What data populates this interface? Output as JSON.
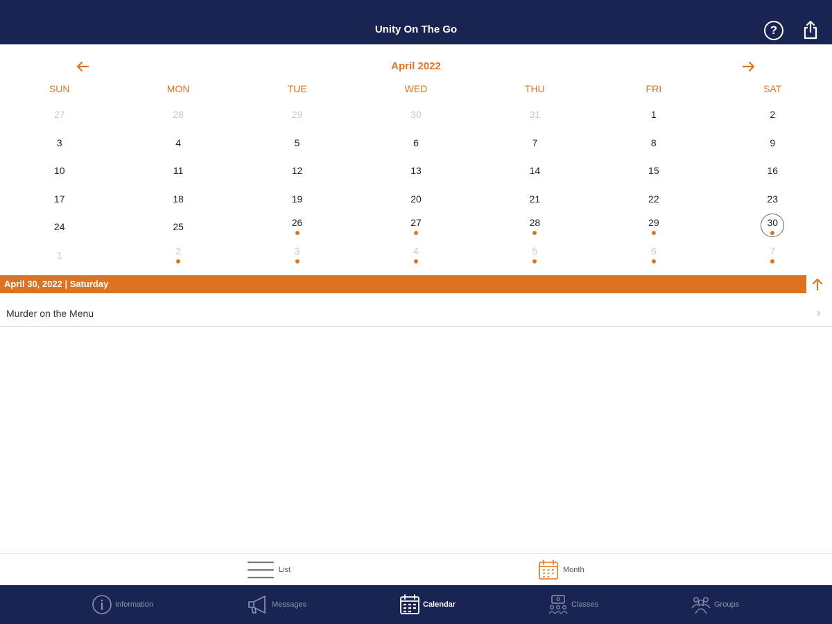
{
  "header": {
    "title": "Unity On The Go",
    "help_glyph": "?"
  },
  "calendar": {
    "month_label": "April 2022",
    "weekdays": [
      "SUN",
      "MON",
      "TUE",
      "WED",
      "THU",
      "FRI",
      "SAT"
    ],
    "weeks": [
      [
        {
          "d": "27",
          "other": true
        },
        {
          "d": "28",
          "other": true
        },
        {
          "d": "29",
          "other": true
        },
        {
          "d": "30",
          "other": true
        },
        {
          "d": "31",
          "other": true
        },
        {
          "d": "1"
        },
        {
          "d": "2"
        }
      ],
      [
        {
          "d": "3"
        },
        {
          "d": "4"
        },
        {
          "d": "5"
        },
        {
          "d": "6"
        },
        {
          "d": "7"
        },
        {
          "d": "8"
        },
        {
          "d": "9"
        }
      ],
      [
        {
          "d": "10"
        },
        {
          "d": "11"
        },
        {
          "d": "12"
        },
        {
          "d": "13"
        },
        {
          "d": "14"
        },
        {
          "d": "15"
        },
        {
          "d": "16"
        }
      ],
      [
        {
          "d": "17"
        },
        {
          "d": "18"
        },
        {
          "d": "19"
        },
        {
          "d": "20"
        },
        {
          "d": "21"
        },
        {
          "d": "22"
        },
        {
          "d": "23"
        }
      ],
      [
        {
          "d": "24"
        },
        {
          "d": "25"
        },
        {
          "d": "26",
          "dot": true
        },
        {
          "d": "27",
          "dot": true
        },
        {
          "d": "28",
          "dot": true
        },
        {
          "d": "29",
          "dot": true
        },
        {
          "d": "30",
          "dot": true,
          "selected": true
        }
      ],
      [
        {
          "d": "1",
          "other": true
        },
        {
          "d": "2",
          "other": true,
          "dot": true
        },
        {
          "d": "3",
          "other": true,
          "dot": true
        },
        {
          "d": "4",
          "other": true,
          "dot": true
        },
        {
          "d": "5",
          "other": true,
          "dot": true
        },
        {
          "d": "6",
          "other": true,
          "dot": true
        },
        {
          "d": "7",
          "other": true,
          "dot": true
        }
      ]
    ]
  },
  "selected_date": {
    "label": "April 30, 2022 | Saturday"
  },
  "events": [
    {
      "title": "Murder on the Menu",
      "chevron": "›"
    }
  ],
  "view_switch": {
    "list_label": "List",
    "month_label": "Month"
  },
  "tabs": {
    "information": "Information",
    "messages": "Messages",
    "calendar": "Calendar",
    "classes": "Classes",
    "groups": "Groups"
  },
  "colors": {
    "navy": "#1a2452",
    "accent": "#dd7320"
  }
}
